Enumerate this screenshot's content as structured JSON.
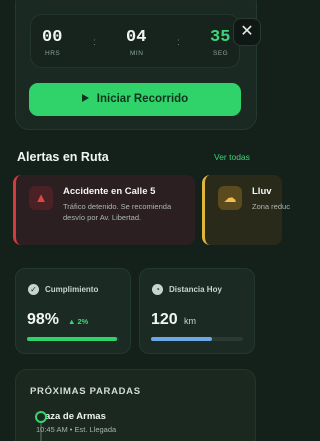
{
  "timer": {
    "hours": "00",
    "hours_label": "HRS",
    "minutes": "04",
    "minutes_label": "MIN",
    "seconds": "35",
    "seconds_label": "SEG"
  },
  "start_button": {
    "label": "Iniciar Recorrido"
  },
  "close_button": {
    "icon": "close-icon"
  },
  "alerts": {
    "title": "Alertas en Ruta",
    "see_all": "Ver todas",
    "items": [
      {
        "title": "Accidente en Calle 5",
        "description": "Tráfico detenido. Se recomienda desvío por Av. Libertad.",
        "color": "#d8393c",
        "icon": "warning-icon"
      },
      {
        "title": "Lluv",
        "description": "Zona reduc",
        "color": "#e0b63a",
        "icon": "rain-cloud-icon"
      }
    ]
  },
  "stats": {
    "compliance": {
      "label": "Cumplimiento",
      "value": "98%",
      "trend": "2%",
      "progress": 0.98,
      "color": "#2fd36a"
    },
    "distance": {
      "label": "Distancia Hoy",
      "value": "120",
      "unit": "km",
      "progress": 0.66,
      "color": "#6aa8e8"
    }
  },
  "stops": {
    "title": "PRÓXIMAS PARADAS",
    "items": [
      {
        "name": "Plaza de Armas",
        "meta": "10:45 AM • Est. Llegada"
      }
    ]
  }
}
